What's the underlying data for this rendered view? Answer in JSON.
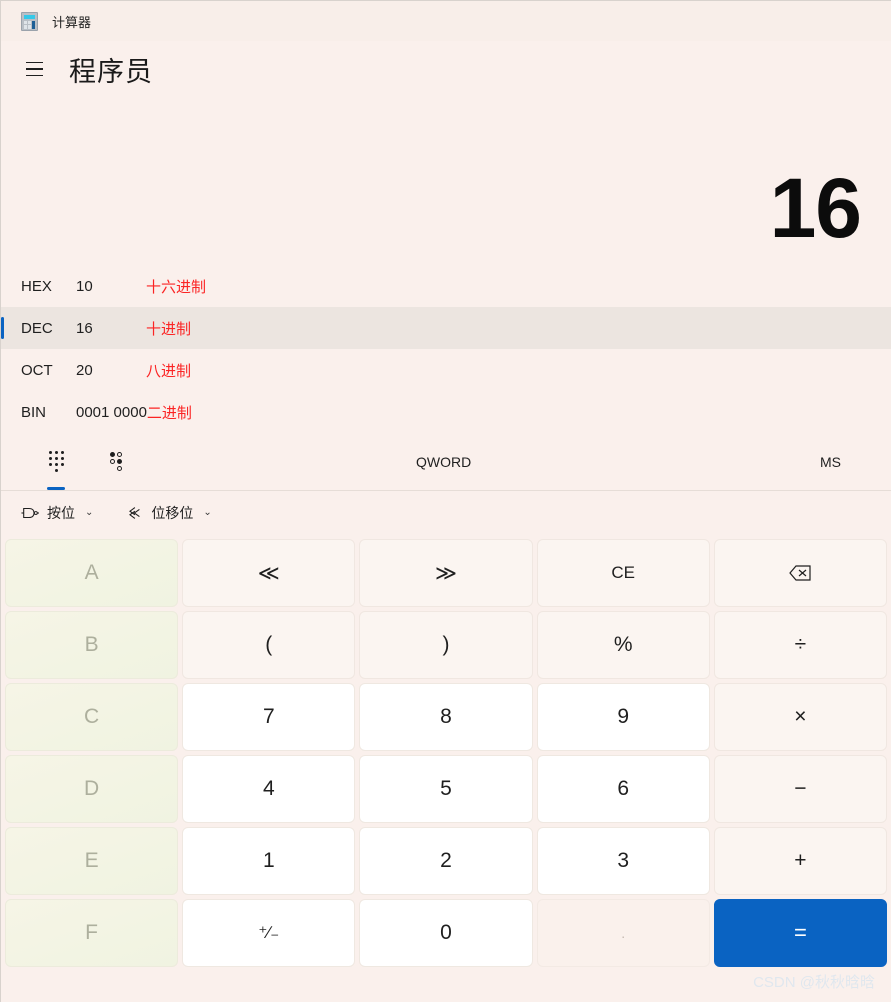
{
  "window": {
    "title": "计算器",
    "icon": "calculator-icon"
  },
  "header": {
    "menu_icon": "hamburger-menu-icon",
    "mode_title": "程序员"
  },
  "display": {
    "value": "16"
  },
  "radix": {
    "rows": [
      {
        "abbr": "HEX",
        "value": "10",
        "note": "十六进制",
        "selected": false
      },
      {
        "abbr": "DEC",
        "value": "16",
        "note": "十进制",
        "selected": true
      },
      {
        "abbr": "OCT",
        "value": "20",
        "note": "八进制",
        "selected": false
      },
      {
        "abbr": "BIN",
        "value": "0001 0000",
        "note": "二进制",
        "selected": false
      }
    ]
  },
  "toolbar": {
    "keypad_tab_icon": "keypad-icon",
    "bit_toggle_tab_icon": "bit-toggle-icon",
    "word_size": "QWORD",
    "memory_store": "MS"
  },
  "functions": {
    "bitwise_label": "按位",
    "bitwise_icon": "logic-gate-icon",
    "bitshift_label": "位移位",
    "bitshift_icon": "bit-shift-icon",
    "chevron": "⌄"
  },
  "keys": [
    {
      "label": "A",
      "name": "key-hex-a",
      "style": "hex-disabled"
    },
    {
      "label": "≪",
      "name": "key-shift-left",
      "style": "op"
    },
    {
      "label": "≫",
      "name": "key-shift-right",
      "style": "op"
    },
    {
      "label": "CE",
      "name": "key-clear-entry",
      "style": "op"
    },
    {
      "label": "⌫",
      "name": "key-backspace",
      "style": "op"
    },
    {
      "label": "B",
      "name": "key-hex-b",
      "style": "hex-disabled"
    },
    {
      "label": "(",
      "name": "key-paren-open",
      "style": "op"
    },
    {
      "label": ")",
      "name": "key-paren-close",
      "style": "op"
    },
    {
      "label": "%",
      "name": "key-percent",
      "style": "op"
    },
    {
      "label": "÷",
      "name": "key-divide",
      "style": "op"
    },
    {
      "label": "C",
      "name": "key-hex-c",
      "style": "hex-disabled"
    },
    {
      "label": "7",
      "name": "key-7",
      "style": "num"
    },
    {
      "label": "8",
      "name": "key-8",
      "style": "num"
    },
    {
      "label": "9",
      "name": "key-9",
      "style": "num"
    },
    {
      "label": "×",
      "name": "key-multiply",
      "style": "op"
    },
    {
      "label": "D",
      "name": "key-hex-d",
      "style": "hex-disabled"
    },
    {
      "label": "4",
      "name": "key-4",
      "style": "num"
    },
    {
      "label": "5",
      "name": "key-5",
      "style": "num"
    },
    {
      "label": "6",
      "name": "key-6",
      "style": "num"
    },
    {
      "label": "−",
      "name": "key-subtract",
      "style": "op"
    },
    {
      "label": "E",
      "name": "key-hex-e",
      "style": "hex-disabled"
    },
    {
      "label": "1",
      "name": "key-1",
      "style": "num"
    },
    {
      "label": "2",
      "name": "key-2",
      "style": "num"
    },
    {
      "label": "3",
      "name": "key-3",
      "style": "num"
    },
    {
      "label": "+",
      "name": "key-add",
      "style": "op"
    },
    {
      "label": "F",
      "name": "key-hex-f",
      "style": "hex-disabled"
    },
    {
      "label": "⁺∕₋",
      "name": "key-sign-toggle",
      "style": "num"
    },
    {
      "label": "0",
      "name": "key-0",
      "style": "num"
    },
    {
      "label": ".",
      "name": "key-decimal",
      "style": "disabled"
    },
    {
      "label": "=",
      "name": "key-equals",
      "style": "equals"
    }
  ],
  "watermark": {
    "text": "CSDN @秋秋晗晗"
  },
  "colors": {
    "background": "#faf0ec",
    "accent": "#0a63c2",
    "annotation_red": "#fb2424",
    "hex_disabled": "#f2f4e4"
  }
}
